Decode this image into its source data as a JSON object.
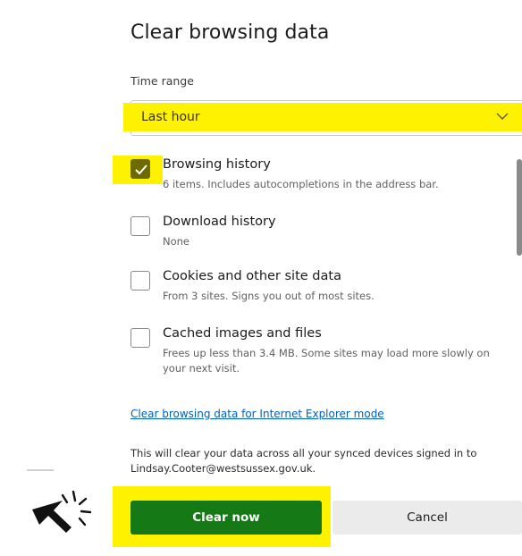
{
  "dialog": {
    "title": "Clear browsing data",
    "time_range_label": "Time range",
    "time_range_value": "Last hour"
  },
  "items": [
    {
      "title": "Browsing history",
      "description": "6 items. Includes autocompletions in the address bar.",
      "checked": true
    },
    {
      "title": "Download history",
      "description": "None",
      "checked": false
    },
    {
      "title": "Cookies and other site data",
      "description": "From 3 sites. Signs you out of most sites.",
      "checked": false
    },
    {
      "title": "Cached images and files",
      "description": "Frees up less than 3.4 MB. Some sites may load more slowly on your next visit.",
      "checked": false
    }
  ],
  "ie_mode_link": "Clear browsing data for Internet Explorer mode",
  "sync_notice": {
    "line1": "This will clear your data across all your synced devices signed in to",
    "line2": "Lindsay.Cooter@westsussex.gov.uk."
  },
  "buttons": {
    "clear_now": "Clear now",
    "cancel": "Cancel"
  },
  "colors": {
    "highlight": "#fff200",
    "primary_button": "#157a15",
    "checkbox_checked": "#6b6b00",
    "link": "#0060c0"
  },
  "icons": {
    "dropdown": "chevron-down-icon",
    "check": "checkmark-icon",
    "pointer": "click-cursor-icon"
  }
}
